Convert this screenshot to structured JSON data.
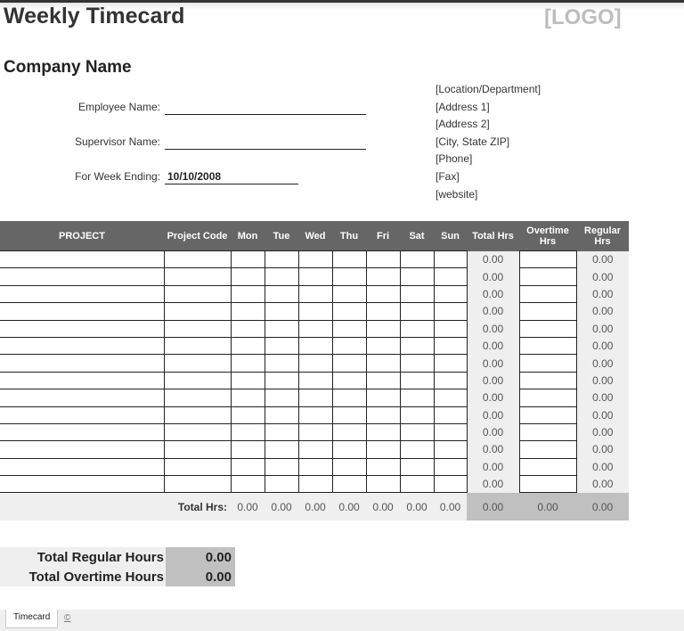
{
  "header": {
    "title": "Weekly Timecard",
    "logo": "[LOGO]",
    "company": "Company Name"
  },
  "fields": {
    "employee_label": "Employee Name:",
    "employee_value": "",
    "supervisor_label": "Supervisor Name:",
    "supervisor_value": "",
    "week_label": "For Week Ending:",
    "week_value": "10/10/2008"
  },
  "address": [
    "[Location/Department]",
    "[Address 1]",
    "[Address 2]",
    "[City, State ZIP]",
    "[Phone]",
    "[Fax]",
    "[website]"
  ],
  "table": {
    "columns": [
      "PROJECT",
      "Project Code",
      "Mon",
      "Tue",
      "Wed",
      "Thu",
      "Fri",
      "Sat",
      "Sun",
      "Total Hrs",
      "Overtime Hrs",
      "Regular Hrs"
    ],
    "rows": [
      {
        "total": "0.00",
        "regular": "0.00"
      },
      {
        "total": "0.00",
        "regular": "0.00"
      },
      {
        "total": "0.00",
        "regular": "0.00"
      },
      {
        "total": "0.00",
        "regular": "0.00"
      },
      {
        "total": "0.00",
        "regular": "0.00"
      },
      {
        "total": "0.00",
        "regular": "0.00"
      },
      {
        "total": "0.00",
        "regular": "0.00"
      },
      {
        "total": "0.00",
        "regular": "0.00"
      },
      {
        "total": "0.00",
        "regular": "0.00"
      },
      {
        "total": "0.00",
        "regular": "0.00"
      },
      {
        "total": "0.00",
        "regular": "0.00"
      },
      {
        "total": "0.00",
        "regular": "0.00"
      },
      {
        "total": "0.00",
        "regular": "0.00"
      },
      {
        "total": "0.00",
        "regular": "0.00"
      }
    ],
    "totals_label": "Total Hrs:",
    "totals": [
      "0.00",
      "0.00",
      "0.00",
      "0.00",
      "0.00",
      "0.00",
      "0.00",
      "0.00",
      "0.00",
      "0.00"
    ]
  },
  "summary": {
    "regular_label": "Total Regular Hours",
    "regular_value": "0.00",
    "overtime_label": "Total Overtime Hours",
    "overtime_value": "0.00"
  },
  "sheets": {
    "active_tab": "Timecard",
    "extra_icon": "©"
  }
}
